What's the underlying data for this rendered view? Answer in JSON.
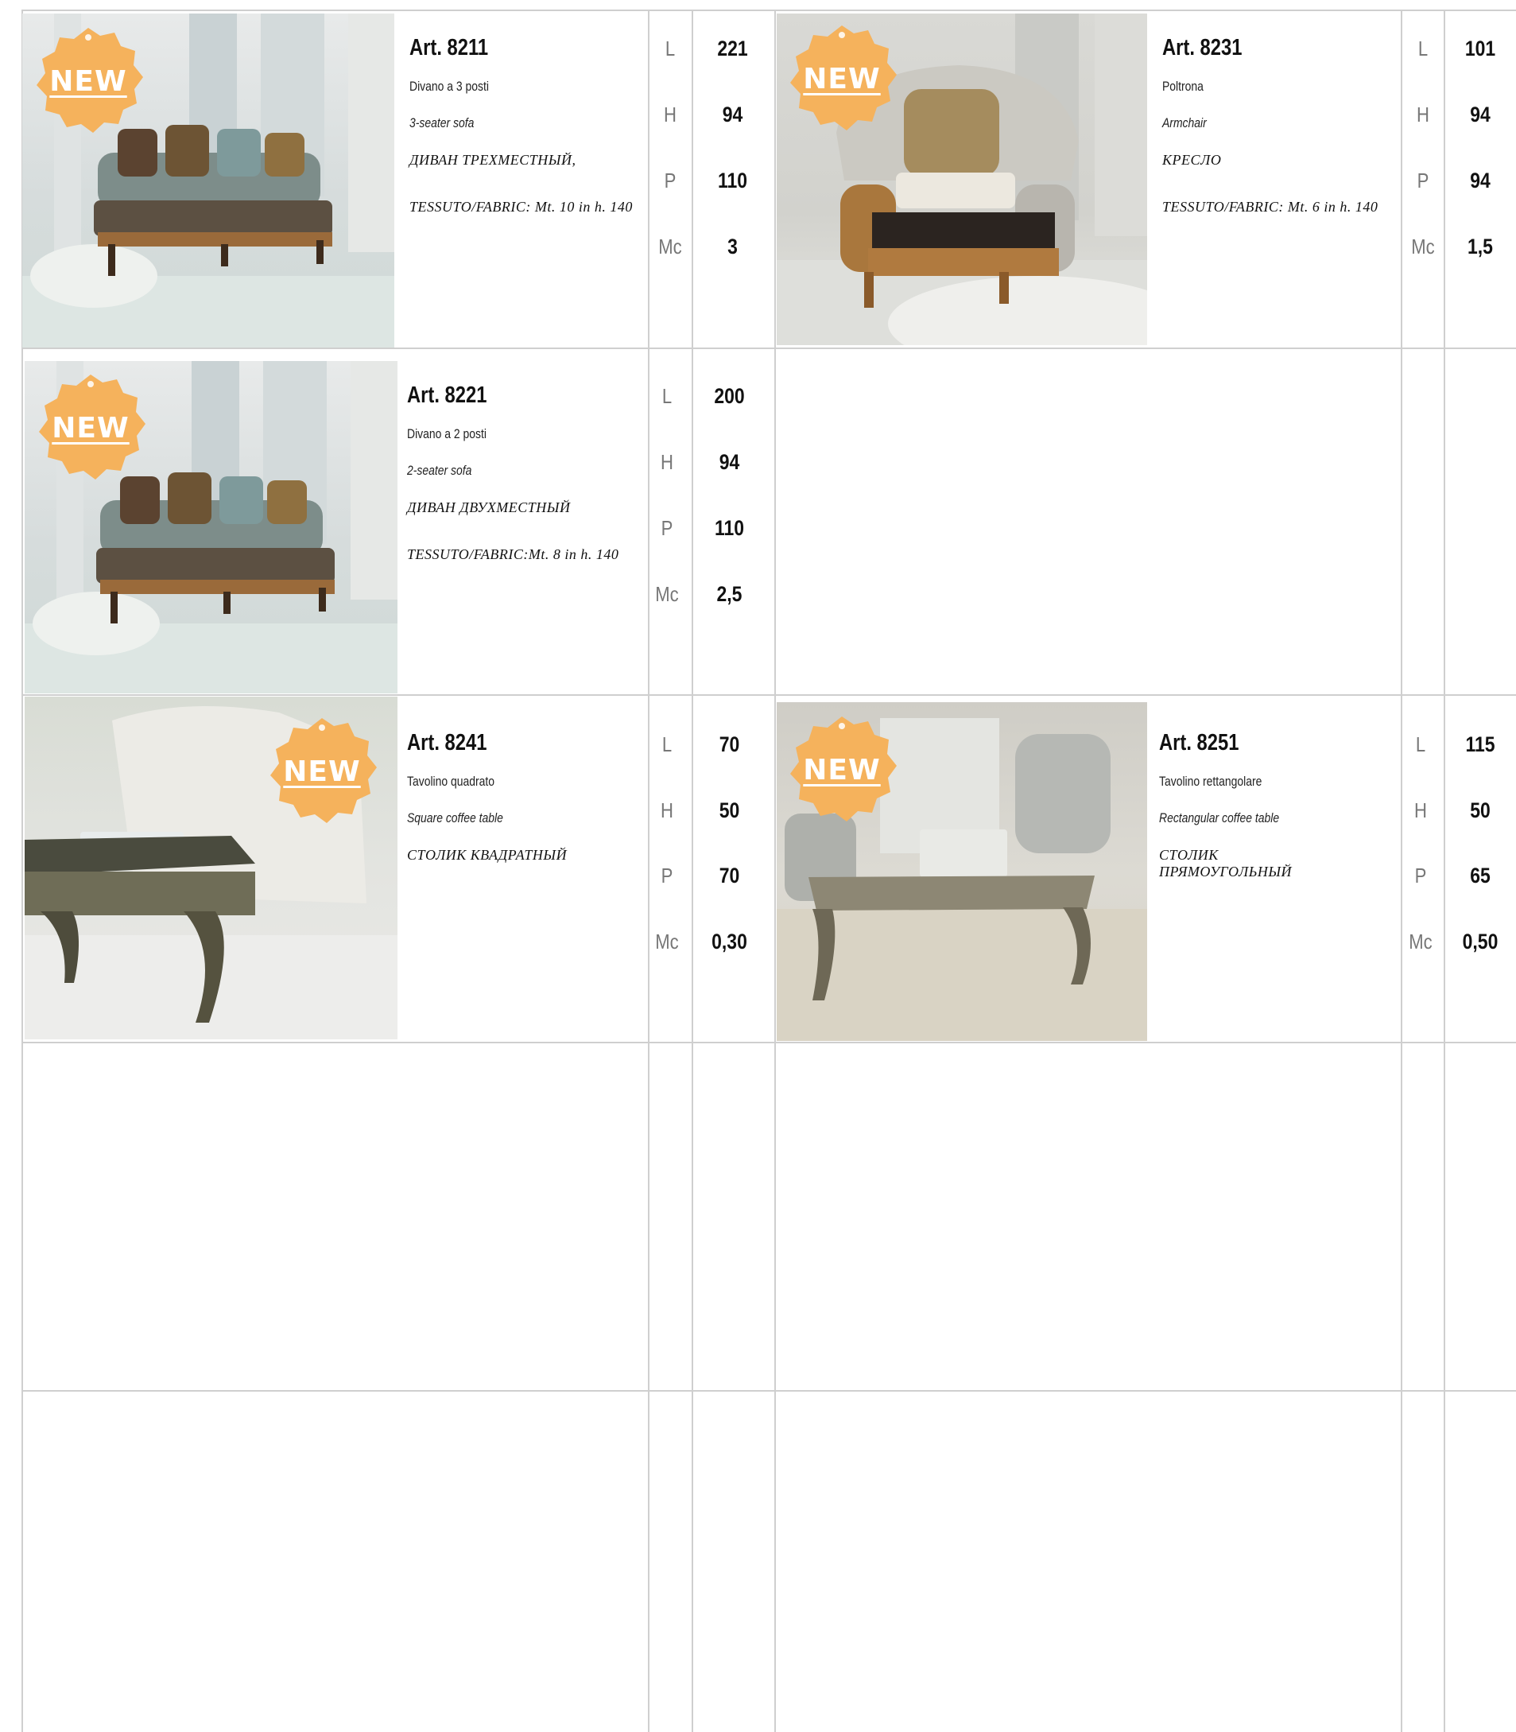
{
  "badge_text": "NEW",
  "colors": {
    "badge": "#f5b25c",
    "grid": "#cfcfcf"
  },
  "dimension_labels": [
    "L",
    "H",
    "P",
    "Mc"
  ],
  "products": [
    {
      "art": "Art. 8211",
      "name_it": "Divano a 3 posti",
      "name_en": "3-seater sofa",
      "name_ru": "ДИВАН ТРЕХМЕСТНЫЙ,",
      "fabric": "TESSUTO/FABRIC: Mt. 10 in h. 140",
      "image": "sofa-3-seater-image",
      "values": [
        "221",
        "94",
        "110",
        "3"
      ]
    },
    {
      "art": "Art. 8231",
      "name_it": "Poltrona",
      "name_en": "Armchair",
      "name_ru": "КРЕСЛО",
      "fabric": "TESSUTO/FABRIC: Mt. 6 in h. 140",
      "image": "armchair-image",
      "values": [
        "101",
        "94",
        "94",
        "1,5"
      ]
    },
    {
      "art": "Art. 8221",
      "name_it": "Divano a 2 posti",
      "name_en": "2-seater sofa",
      "name_ru": "ДИВАН ДВУХМЕСТНЫЙ",
      "fabric": "TESSUTO/FABRIC:Mt. 8 in h. 140",
      "image": "sofa-2-seater-image",
      "values": [
        "200",
        "94",
        "110",
        "2,5"
      ]
    },
    {
      "art": "Art. 8241",
      "name_it": "Tavolino quadrato",
      "name_en": "Square coffee table",
      "name_ru": "СТОЛИК КВАДРАТНЫЙ",
      "image": "square-coffee-table-image",
      "values": [
        "70",
        "50",
        "70",
        "0,30"
      ]
    },
    {
      "art": "Art. 8251",
      "name_it": "Tavolino rettangolare",
      "name_en": "Rectangular coffee table",
      "name_ru": "СТОЛИК ПРЯМОУГОЛЬНЫЙ",
      "image": "rectangular-coffee-table-image",
      "values": [
        "115",
        "50",
        "65",
        "0,50"
      ]
    }
  ]
}
